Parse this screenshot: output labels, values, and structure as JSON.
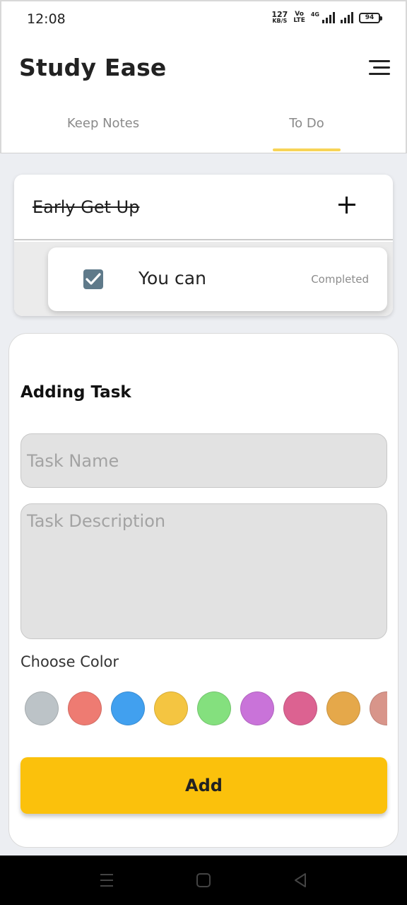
{
  "status_bar": {
    "time": "12:08",
    "net_speed_value": "127",
    "net_speed_unit": "KB/S",
    "volte_top": "Vo",
    "volte_bottom": "LTE",
    "network_type": "4G",
    "battery_level": "94",
    "icons": [
      "network-speed-icon",
      "volte-icon",
      "signal-4g-icon",
      "signal-icon",
      "battery-icon"
    ]
  },
  "header": {
    "title": "Study Ease",
    "menu_icon": "hamburger-menu-icon",
    "tabs": [
      {
        "label": "Keep Notes",
        "active": false
      },
      {
        "label": "To Do",
        "active": true
      }
    ],
    "accent_color": "#f7d457"
  },
  "task": {
    "title": "Early Get Up",
    "completed": true,
    "add_icon": "plus-icon",
    "subtasks": [
      {
        "label": "You can",
        "status": "Completed",
        "checked": true,
        "check_color": "#5f7a8a"
      }
    ]
  },
  "form": {
    "title": "Adding Task",
    "name_placeholder": "Task Name",
    "description_placeholder": "Task Description",
    "color_label": "Choose Color",
    "colors": [
      "#bcc3c7",
      "#ee7b72",
      "#41a0ef",
      "#f4c541",
      "#84e07e",
      "#c973d9",
      "#dc6291",
      "#e5a84a",
      "#d8958a"
    ],
    "add_button_label": "Add",
    "add_button_color": "#fbc10c"
  },
  "nav_bar": {
    "icons": [
      "recent-apps-icon",
      "home-icon",
      "back-icon"
    ]
  }
}
